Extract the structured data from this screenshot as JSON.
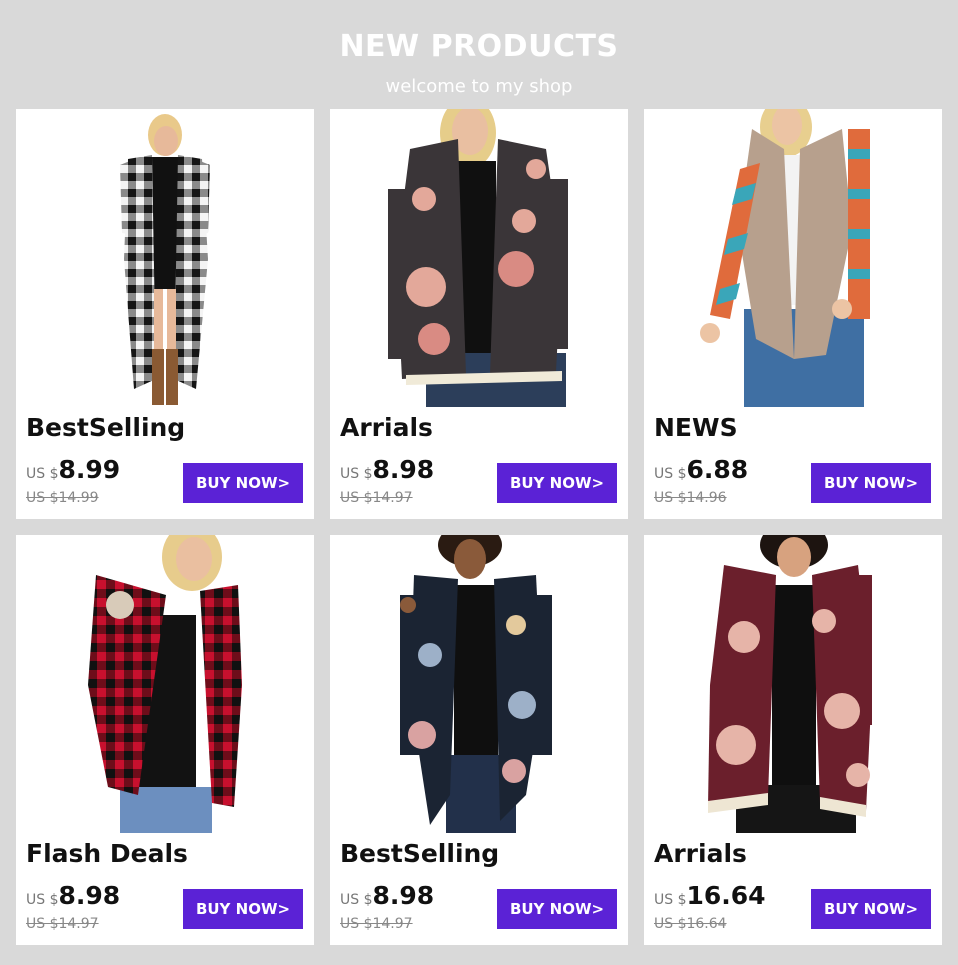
{
  "header": {
    "title": "NEW PRODUCTS",
    "subtitle": "welcome to my shop"
  },
  "colors": {
    "page_background": "#d9d9d9",
    "button": "#5b22d6",
    "card": "#ffffff"
  },
  "products": [
    {
      "label": "BestSelling",
      "currency": "US $",
      "price": "8.99",
      "old_price": "US $14.99",
      "button": "BUY NOW>",
      "image": "black-white-plaid-long-cardigan"
    },
    {
      "label": "Arrials",
      "currency": "US $",
      "price": "8.98",
      "old_price": "US $14.97",
      "button": "BUY NOW>",
      "image": "grey-floral-lace-cardigan"
    },
    {
      "label": "NEWS",
      "currency": "US $",
      "price": "6.88",
      "old_price": "US $14.96",
      "button": "BUY NOW>",
      "image": "khaki-aztec-sleeve-cardigan"
    },
    {
      "label": "Flash Deals",
      "currency": "US $",
      "price": "8.98",
      "old_price": "US $14.97",
      "button": "BUY NOW>",
      "image": "red-plaid-elbow-patch-cardigan"
    },
    {
      "label": "BestSelling",
      "currency": "US $",
      "price": "8.98",
      "old_price": "US $14.97",
      "button": "BUY NOW>",
      "image": "navy-floral-cardigan"
    },
    {
      "label": "Arrials",
      "currency": "US $",
      "price": "16.64",
      "old_price": "US $16.64",
      "button": "BUY NOW>",
      "image": "burgundy-floral-lace-cardigan"
    }
  ]
}
